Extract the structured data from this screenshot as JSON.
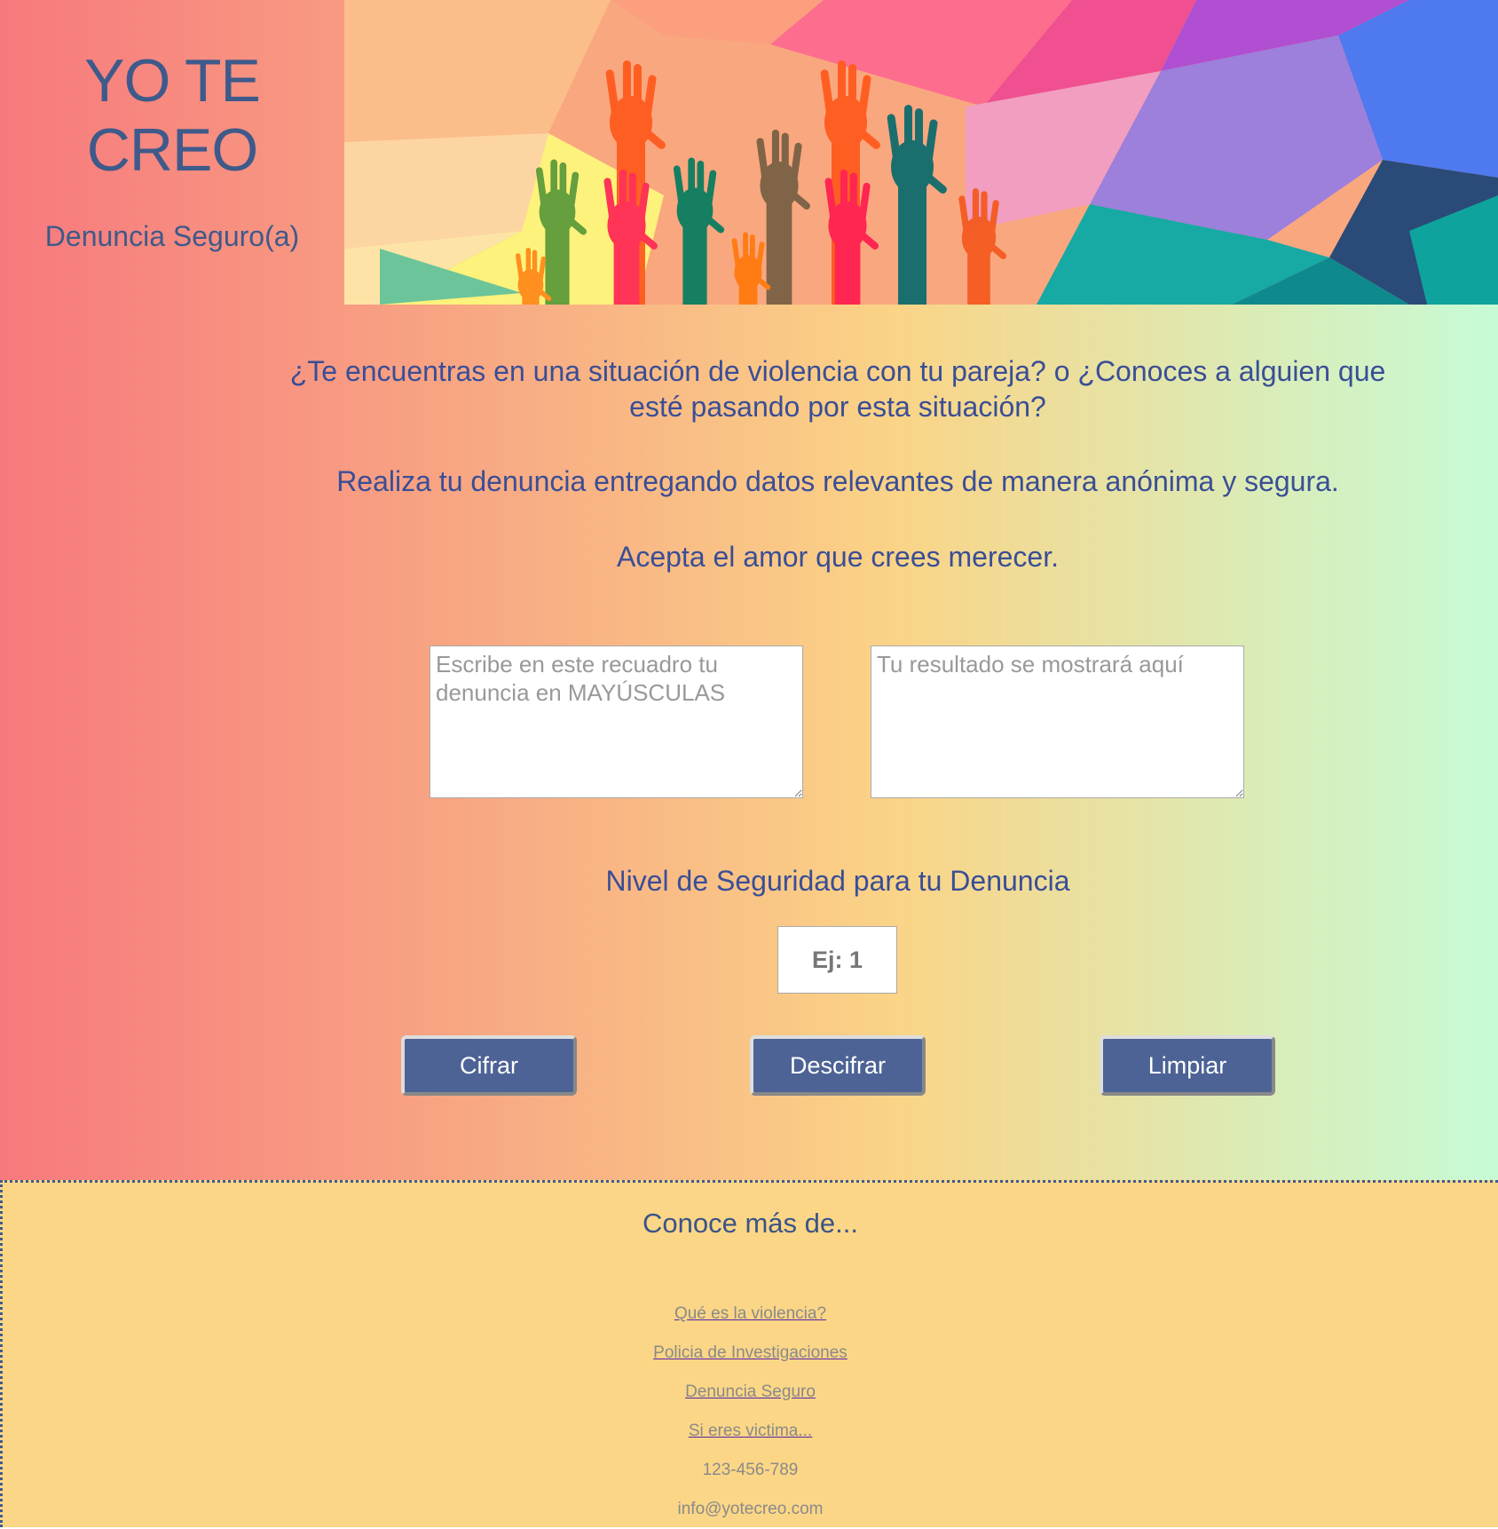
{
  "header": {
    "title": "YO TE CREO",
    "subtitle": "Denuncia Seguro(a)"
  },
  "intro": {
    "question": "¿Te encuentras en una situación de violencia con tu pareja? o ¿Conoces a alguien que esté pasando por esta situación?",
    "instruction": "Realiza tu denuncia entregando datos relevantes de manera anónima y segura.",
    "motto": "Acepta el amor que crees merecer."
  },
  "form": {
    "input_placeholder": "Escribe en este recuadro tu denuncia en MAYÚSCULAS",
    "output_placeholder": "Tu resultado se mostrará aquí",
    "level_label": "Nivel de Seguridad para tu Denuncia",
    "level_placeholder": "Ej: 1",
    "buttons": {
      "encrypt": "Cifrar",
      "decrypt": "Descifrar",
      "clear": "Limpiar"
    }
  },
  "footer": {
    "heading": "Conoce más de...",
    "links": [
      "Qué es la violencia?",
      "Policia de Investigaciones",
      "Denuncia Seguro",
      "Si eres victima..."
    ],
    "phone": "123-456-789",
    "email": "info@yotecreo.com"
  },
  "colors": {
    "text": "#3a5488",
    "button": "#4d6395",
    "footer_bg": "#fbd686"
  }
}
